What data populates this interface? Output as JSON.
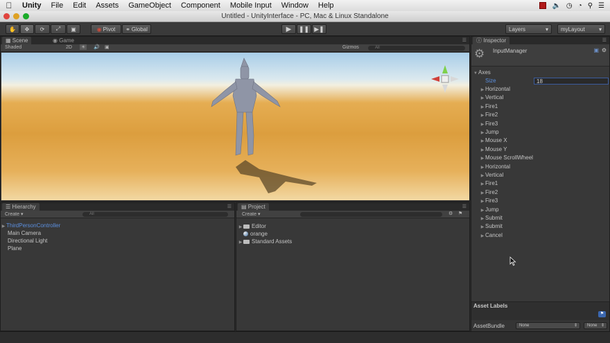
{
  "menubar": {
    "app_name": "Unity",
    "items": [
      "File",
      "Edit",
      "Assets",
      "GameObject",
      "Component",
      "Mobile Input",
      "Window",
      "Help"
    ]
  },
  "window": {
    "title": "Untitled - UnityInterface - PC, Mac & Linux Standalone"
  },
  "toolbar": {
    "pivot": "Pivot",
    "global": "Global",
    "layers": "Layers",
    "layout": "myLayout"
  },
  "scene": {
    "tab_scene": "Scene",
    "tab_game": "Game",
    "shading": "Shaded",
    "mode_2d": "2D",
    "gizmos": "Gizmos",
    "search_placeholder": "All"
  },
  "hierarchy": {
    "tab": "Hierarchy",
    "create": "Create",
    "search_placeholder": "All",
    "items": [
      {
        "label": "ThirdPersonController",
        "selected": true
      },
      {
        "label": "Main Camera"
      },
      {
        "label": "Directional Light"
      },
      {
        "label": "Plane"
      }
    ]
  },
  "project": {
    "tab": "Project",
    "create": "Create",
    "items": [
      {
        "label": "Editor",
        "kind": "folder"
      },
      {
        "label": "orange",
        "kind": "material"
      },
      {
        "label": "Standard Assets",
        "kind": "folder"
      }
    ]
  },
  "inspector": {
    "tab": "Inspector",
    "asset_name": "InputManager",
    "axes_label": "Axes",
    "size_label": "Size",
    "size_value": "18",
    "axes": [
      "Horizontal",
      "Vertical",
      "Fire1",
      "Fire2",
      "Fire3",
      "Jump",
      "Mouse X",
      "Mouse Y",
      "Mouse ScrollWheel",
      "Horizontal",
      "Vertical",
      "Fire1",
      "Fire2",
      "Fire3",
      "Jump",
      "Submit",
      "Submit",
      "Cancel"
    ],
    "asset_labels": "Asset Labels",
    "asset_bundle_label": "AssetBundle",
    "bundle_value": "None",
    "variant_value": "None"
  },
  "colors": {
    "selection_blue": "#5b8fdf",
    "accent_field": "#3b5c9e"
  }
}
